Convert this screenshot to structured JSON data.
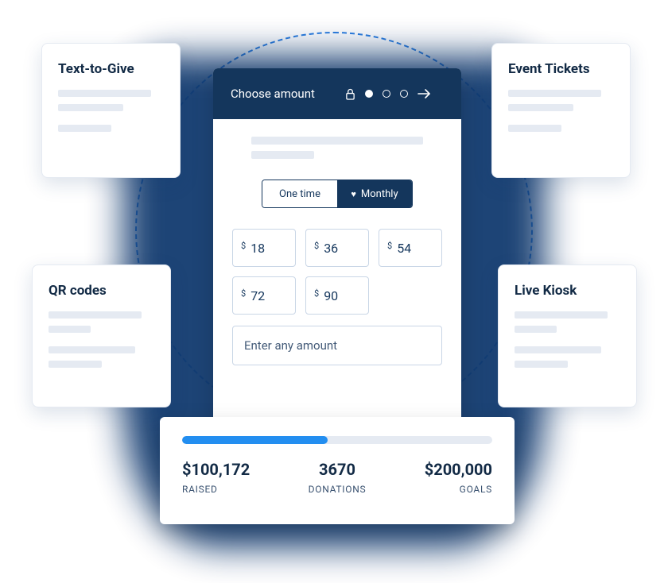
{
  "float_cards": {
    "top_left": {
      "title": "Text-to-Give"
    },
    "top_right": {
      "title": "Event Tickets"
    },
    "bottom_left": {
      "title": "QR codes"
    },
    "bottom_right": {
      "title": "Live Kiosk"
    }
  },
  "main": {
    "header_title": "Choose amount",
    "frequency": {
      "one_time": "One time",
      "monthly": "Monthly"
    },
    "currency": "$",
    "amounts": [
      "18",
      "36",
      "54",
      "72",
      "90"
    ],
    "any_amount_placeholder": "Enter any amount"
  },
  "stats": {
    "progress_percent": 47,
    "raised": {
      "value": "$100,172",
      "label": "RAISED"
    },
    "donations": {
      "value": "3670",
      "label": "DONATIONS"
    },
    "goals": {
      "value": "$200,000",
      "label": "GOALS"
    }
  }
}
